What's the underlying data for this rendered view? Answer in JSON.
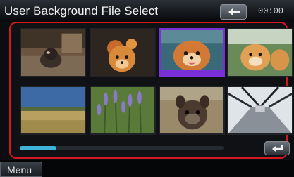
{
  "header": {
    "title": "User Background File Select",
    "time": "00:00"
  },
  "thumbnails": [
    {
      "subject": "pug sitting indoors"
    },
    {
      "subject": "pomeranian with flowers"
    },
    {
      "subject": "pomeranian smiling",
      "selected": true
    },
    {
      "subject": "pomeranian sitting on lawn"
    },
    {
      "subject": "countryside field landscape"
    },
    {
      "subject": "lavender flowers"
    },
    {
      "subject": "french bulldog"
    },
    {
      "subject": "steel footbridge"
    }
  ],
  "scroll": {
    "position": 0,
    "visible_fraction": 0.18
  },
  "bottom": {
    "menu_label": "Menu"
  },
  "colors": {
    "selection_border": "#d41820",
    "highlight": "#7b2fd6",
    "scroll_accent": "#3fb3d9"
  },
  "icons": {
    "back": "back-arrow-icon",
    "return": "return-arrow-icon"
  }
}
